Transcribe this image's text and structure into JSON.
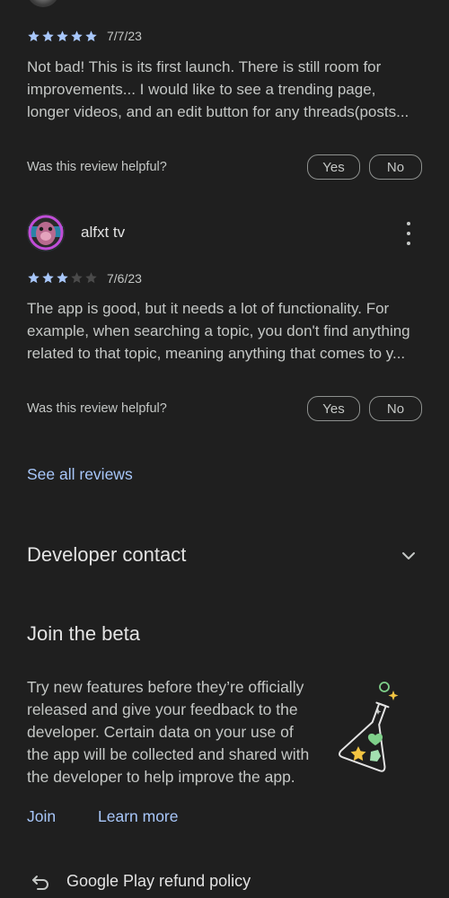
{
  "review1": {
    "rating": 5,
    "max_rating": 5,
    "date": "7/7/23",
    "body_lines": [
      "Not bad! This is its first launch. There is still room for",
      "improvements... I would like to see a trending page,",
      "longer videos, and an edit button for any threads(posts..."
    ],
    "helpful_label": "Was this review helpful?",
    "yes_label": "Yes",
    "no_label": "No"
  },
  "review2": {
    "reviewer_name": "alfxt tv",
    "rating": 3,
    "max_rating": 5,
    "date": "7/6/23",
    "body_lines": [
      "The app is good, but it needs a lot of functionality. For",
      "example, when searching a topic, you don't find anything",
      "related to that topic, meaning anything that comes to y..."
    ],
    "helpful_label": "Was this review helpful?",
    "yes_label": "Yes",
    "no_label": "No"
  },
  "see_all_reviews": "See all reviews",
  "developer_contact": {
    "title": "Developer contact",
    "icon": "chevron-down-icon"
  },
  "beta": {
    "title": "Join the beta",
    "body_lines": [
      "Try new features before they’re officially",
      "released and give your feedback to the",
      "developer. Certain data on your use of",
      "the app will be collected and shared with",
      "the developer to help improve the app."
    ],
    "join_label": "Join",
    "learn_more_label": "Learn more",
    "illustration": "beta-flask-icon"
  },
  "refund": {
    "label": "Google Play refund policy",
    "icon": "undo-arrow-icon"
  },
  "colors": {
    "background": "#1f1f1f",
    "accent": "#a8c7fa",
    "text_primary": "#e3e3e3",
    "text_secondary": "#c4c7c5",
    "star_empty": "#4a4a4a"
  }
}
